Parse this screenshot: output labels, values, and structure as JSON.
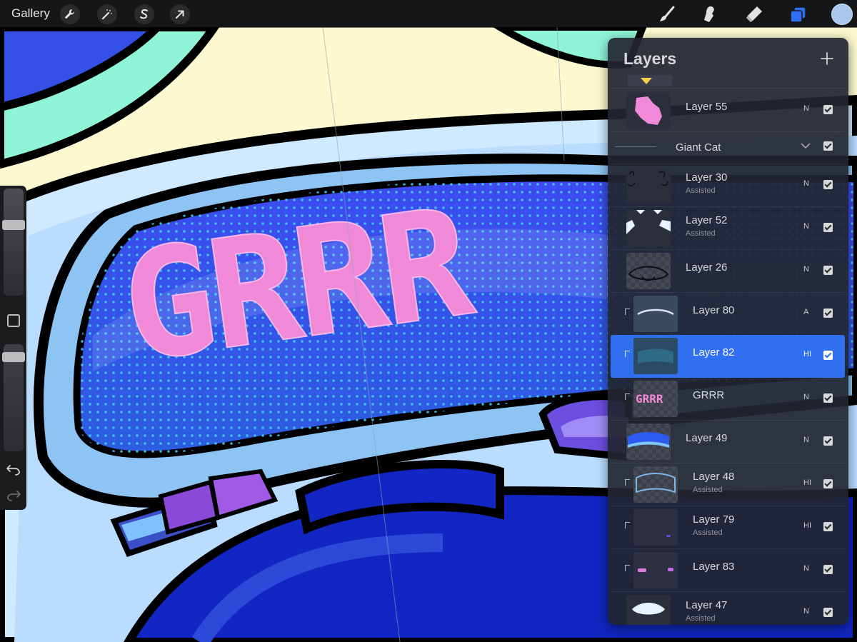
{
  "toolbar": {
    "gallery_label": "Gallery",
    "left_tools": [
      "wrench-icon",
      "magic-wand-icon",
      "selection-s-icon",
      "move-arrow-icon"
    ],
    "right_tools": [
      "brush-icon",
      "smudge-icon",
      "eraser-icon",
      "layers-icon"
    ],
    "active_tool": "layers-icon",
    "current_color": "#a9c6ee"
  },
  "sidebar": {
    "brush_size_level": 0.68,
    "opacity_level": 0.92,
    "undo_icon": "undo-icon",
    "redo_icon": "redo-icon"
  },
  "layers_panel": {
    "title": "Layers",
    "add_icon": "plus-icon",
    "group": {
      "name": "Giant Cat",
      "visible": true
    },
    "layers": [
      {
        "name": "Layer 55",
        "sub": "",
        "mode": "N",
        "visible": true,
        "clipped": false,
        "selected": false
      },
      {
        "name": "Layer 30",
        "sub": "Assisted",
        "mode": "N",
        "visible": true,
        "clipped": false,
        "selected": false
      },
      {
        "name": "Layer 52",
        "sub": "Assisted",
        "mode": "N",
        "visible": true,
        "clipped": false,
        "selected": false
      },
      {
        "name": "Layer 26",
        "sub": "",
        "mode": "N",
        "visible": true,
        "clipped": false,
        "selected": false
      },
      {
        "name": "Layer 80",
        "sub": "",
        "mode": "A",
        "visible": true,
        "clipped": true,
        "selected": false
      },
      {
        "name": "Layer 82",
        "sub": "",
        "mode": "HI",
        "visible": true,
        "clipped": true,
        "selected": true
      },
      {
        "name": "GRRR",
        "sub": "",
        "mode": "N",
        "visible": true,
        "clipped": true,
        "selected": false
      },
      {
        "name": "Layer 49",
        "sub": "",
        "mode": "N",
        "visible": true,
        "clipped": false,
        "selected": false
      },
      {
        "name": "Layer 48",
        "sub": "Assisted",
        "mode": "HI",
        "visible": true,
        "clipped": true,
        "selected": false
      },
      {
        "name": "Layer 79",
        "sub": "Assisted",
        "mode": "HI",
        "visible": true,
        "clipped": true,
        "selected": false
      },
      {
        "name": "Layer 83",
        "sub": "",
        "mode": "N",
        "visible": true,
        "clipped": true,
        "selected": false
      },
      {
        "name": "Layer 47",
        "sub": "Assisted",
        "mode": "N",
        "visible": true,
        "clipped": false,
        "selected": false
      }
    ]
  },
  "canvas": {
    "visor_text": "GRRR",
    "colors": {
      "sky": "#fdf8cf",
      "mint": "#8ff5d6",
      "deep_blue": "#1126c2",
      "light_blue": "#cfe9ff",
      "mid_blue": "#8ec4f4",
      "pink": "#f08ad8",
      "purple": "#8a4ad8"
    }
  }
}
